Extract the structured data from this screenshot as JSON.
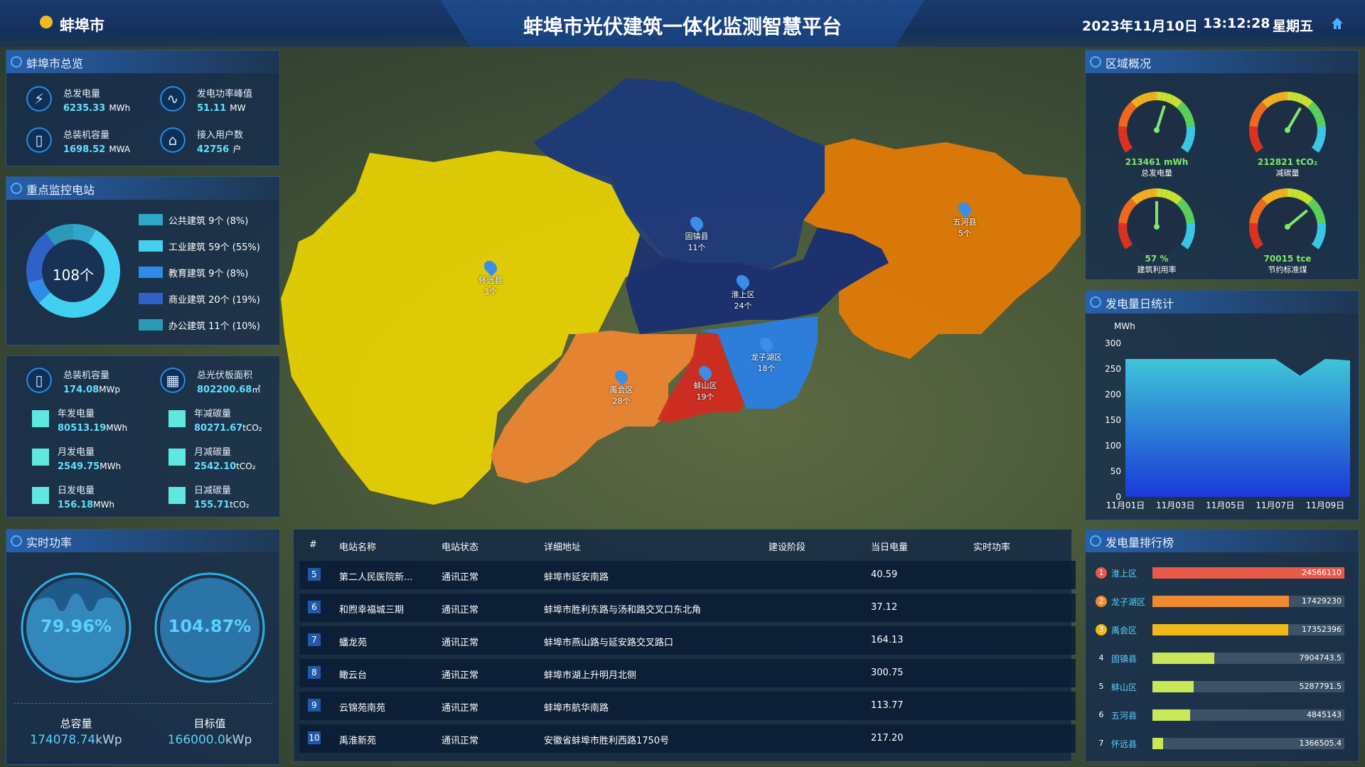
{
  "header": {
    "city": "蚌埠市",
    "title": "蚌埠市光伏建筑一体化监测智慧平台",
    "date": "2023年11月10日",
    "time": "13:12:28",
    "weekday": "星期五"
  },
  "overview": {
    "title": "蚌埠市总览",
    "items": [
      {
        "label": "总发电量",
        "value": "6235.33",
        "unit": "MWh",
        "icon": "lightning-icon"
      },
      {
        "label": "发电功率峰值",
        "value": "51.11",
        "unit": "MW",
        "icon": "pulse-icon"
      },
      {
        "label": "总装机容量",
        "value": "1698.52",
        "unit": "MWA",
        "icon": "battery-icon"
      },
      {
        "label": "接入用户数",
        "value": "42756",
        "unit": "户",
        "icon": "house-icon"
      }
    ]
  },
  "stations": {
    "title": "重点监控电站",
    "total": "108个",
    "legend": [
      {
        "label": "公共建筑 9个 (8%)",
        "color": "#2fa7c9",
        "pct": 8
      },
      {
        "label": "工业建筑 59个 (55%)",
        "color": "#43d0f0",
        "pct": 55
      },
      {
        "label": "教育建筑 9个 (8%)",
        "color": "#2f8be8",
        "pct": 8
      },
      {
        "label": "商业建筑 20个 (19%)",
        "color": "#2e62c8",
        "pct": 19
      },
      {
        "label": "办公建筑 11个 (10%)",
        "color": "#2a9ab8",
        "pct": 10
      }
    ]
  },
  "stats": {
    "top": [
      {
        "label": "总装机容量",
        "value": "174.08",
        "unit": "MWp",
        "icon": "battery-icon"
      },
      {
        "label": "总光伏板面积",
        "value": "802200.68",
        "unit": "㎡",
        "icon": "solar-panel-icon"
      }
    ],
    "rows": [
      {
        "label": "年发电量",
        "value": "80513.19",
        "unit": "MWh"
      },
      {
        "label": "年减碳量",
        "value": "80271.67",
        "unit": "tCO₂"
      },
      {
        "label": "月发电量",
        "value": "2549.75",
        "unit": "MWh"
      },
      {
        "label": "月减碳量",
        "value": "2542.10",
        "unit": "tCO₂"
      },
      {
        "label": "日发电量",
        "value": "156.18",
        "unit": "MWh"
      },
      {
        "label": "日减碳量",
        "value": "155.71",
        "unit": "tCO₂"
      }
    ]
  },
  "realtime": {
    "title": "实时功率",
    "left_pct": "79.96%",
    "right_pct": "104.87%",
    "left_label": "总容量",
    "left_value": "174078.74",
    "left_unit": "kWp",
    "right_label": "目标值",
    "right_value": "166000.0",
    "right_unit": "kWp"
  },
  "map": {
    "regions": [
      {
        "name": "怀远县",
        "count": "3个"
      },
      {
        "name": "固镇县",
        "count": "11个"
      },
      {
        "name": "五河县",
        "count": "5个"
      },
      {
        "name": "淮上区",
        "count": "24个"
      },
      {
        "name": "龙子湖区",
        "count": "18个"
      },
      {
        "name": "禹会区",
        "count": "28个"
      },
      {
        "name": "蚌山区",
        "count": "19个"
      }
    ]
  },
  "table": {
    "headers": [
      "#",
      "电站名称",
      "电站状态",
      "详细地址",
      "建设阶段",
      "当日电量",
      "实时功率"
    ],
    "rows": [
      {
        "no": "5",
        "name": "第二人民医院新...",
        "status": "通讯正常",
        "addr": "蚌埠市延安南路",
        "stage": "",
        "energy": "40.59",
        "power": ""
      },
      {
        "no": "6",
        "name": "和煦幸福城三期",
        "status": "通讯正常",
        "addr": "蚌埠市胜利东路与汤和路交叉口东北角",
        "stage": "",
        "energy": "37.12",
        "power": ""
      },
      {
        "no": "7",
        "name": "蟠龙苑",
        "status": "通讯正常",
        "addr": "蚌埠市燕山路与延安路交叉路口",
        "stage": "",
        "energy": "164.13",
        "power": ""
      },
      {
        "no": "8",
        "name": "瞰云台",
        "status": "通讯正常",
        "addr": "蚌埠市湖上升明月北侧",
        "stage": "",
        "energy": "300.75",
        "power": ""
      },
      {
        "no": "9",
        "name": "云锦苑南苑",
        "status": "通讯正常",
        "addr": "蚌埠市航华南路",
        "stage": "",
        "energy": "113.77",
        "power": ""
      },
      {
        "no": "10",
        "name": "禹淮新苑",
        "status": "通讯正常",
        "addr": "安徽省蚌埠市胜利西路1750号",
        "stage": "",
        "energy": "217.20",
        "power": ""
      }
    ]
  },
  "area": {
    "title": "区域概况",
    "gauges": [
      {
        "value": "213461 mWh",
        "label": "总发电量",
        "level": 0.57
      },
      {
        "value": "212821 tCO₂",
        "label": "减碳量",
        "level": 0.62
      },
      {
        "value": "57 %",
        "label": "建筑利用率",
        "level": 0.5
      },
      {
        "value": "70015 tce",
        "label": "节约标准煤",
        "level": 0.7
      }
    ]
  },
  "chart_data": {
    "type": "area",
    "title": "发电量日统计",
    "ylabel": "MWh",
    "ylim": [
      0,
      300
    ],
    "yticks": [
      0,
      50,
      100,
      150,
      200,
      250,
      300
    ],
    "xticks": [
      "11月01日",
      "11月03日",
      "11月05日",
      "11月07日",
      "11月09日"
    ],
    "x": [
      0,
      1,
      2,
      3,
      4,
      5,
      6,
      7,
      8,
      8.5,
      9
    ],
    "values": [
      268,
      268,
      268,
      268,
      268,
      268,
      268,
      235,
      268,
      267,
      265
    ],
    "color": "#3ec4d8"
  },
  "ranking": {
    "title": "发电量排行榜",
    "max": 24566110,
    "items": [
      {
        "rank": "1",
        "name": "淮上区",
        "value": "24566110",
        "num": 24566110,
        "color": "#e85a48"
      },
      {
        "rank": "2",
        "name": "龙子湖区",
        "value": "17429230",
        "num": 17429230,
        "color": "#f08a30"
      },
      {
        "rank": "3",
        "name": "禹会区",
        "value": "17352396",
        "num": 17352396,
        "color": "#f0b818"
      },
      {
        "rank": "4",
        "name": "固镇县",
        "value": "7904743.5",
        "num": 7904743.5,
        "color": "#c8e858"
      },
      {
        "rank": "5",
        "name": "蚌山区",
        "value": "5287791.5",
        "num": 5287791.5,
        "color": "#c8e858"
      },
      {
        "rank": "6",
        "name": "五河县",
        "value": "4845143",
        "num": 4845143,
        "color": "#c8e858"
      },
      {
        "rank": "7",
        "name": "怀远县",
        "value": "1366505.4",
        "num": 1366505.4,
        "color": "#c8e858"
      }
    ]
  }
}
